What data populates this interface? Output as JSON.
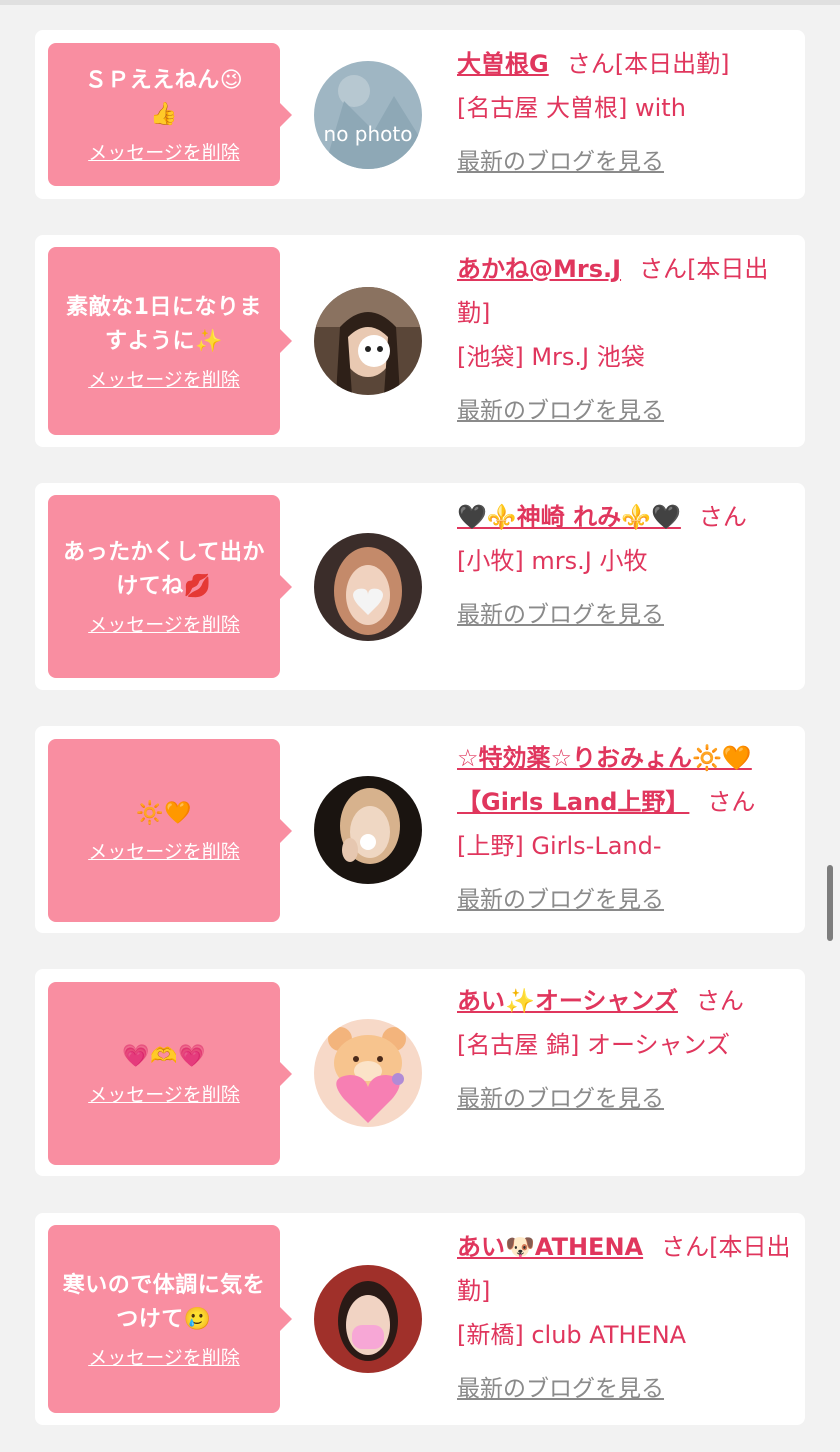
{
  "delete_label": "メッセージを削除",
  "blog_label": "最新のブログを見る",
  "san_label": "さん",
  "colors": {
    "bubble": "#f98ea1",
    "accent": "#e0365d",
    "link_gray": "#8a8a8a",
    "background": "#f2f2f2"
  },
  "entries": [
    {
      "message": "ＳＰええねん😉👍",
      "name": "大曽根G",
      "status": "[本日出勤]",
      "shop": "[名古屋 大曽根] with",
      "avatar": "no photo"
    },
    {
      "message": "素敵な1日になりますように✨",
      "name": "あかね@Mrs.J",
      "status": "[本日出勤]",
      "shop": "[池袋] Mrs.J 池袋"
    },
    {
      "message": "あったかくして出かけてね💋",
      "name": "🖤⚜️神崎 れみ⚜️🖤",
      "status": "",
      "shop": "[小牧] mrs.J 小牧"
    },
    {
      "message": "🔆🧡",
      "name": "☆特効薬☆りおみょん🔆🧡【Girls Land上野】",
      "status": "",
      "shop": "[上野] Girls-Land-"
    },
    {
      "message": "💗🫶💗",
      "name": "あい✨オーシャンズ",
      "status": "",
      "shop": "[名古屋 錦] オーシャンズ"
    },
    {
      "message": "寒いので体調に気をつけて🥲",
      "name": "あい🐶ATHENA",
      "status": "[本日出勤]",
      "shop": "[新橋] club ATHENA"
    }
  ]
}
